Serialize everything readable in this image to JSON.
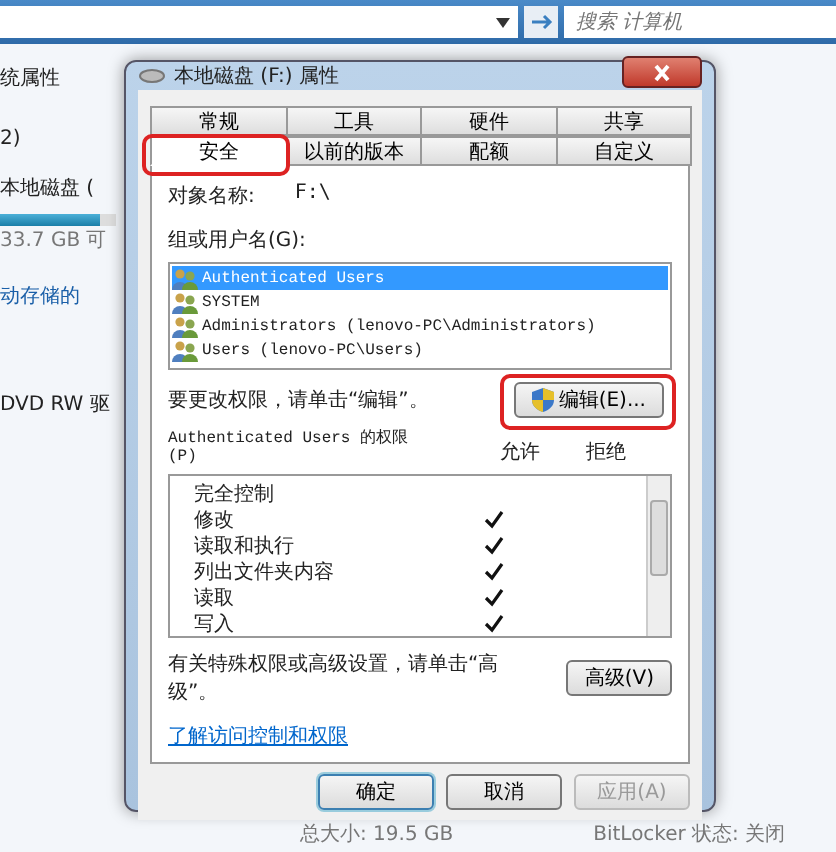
{
  "explorer": {
    "search": {
      "placeholder": "搜索 计算机"
    },
    "toolbar_item": "统属性",
    "section": "2)",
    "drive_name": "本地磁盘 (",
    "drive_bar": {
      "level": 0.63
    },
    "drive_free": "33.7 GB 可",
    "removable": "动存储的",
    "dvd": "DVD RW 驱",
    "total": "总大小: 19.5 GB",
    "bitlocker": "BitLocker 状态: 关闭"
  },
  "dialog": {
    "title": "本地磁盘 (F:) 属性",
    "tabs": [
      [
        {
          "label": "常规",
          "selected": false
        },
        {
          "label": "工具",
          "selected": false
        },
        {
          "label": "硬件",
          "selected": false
        },
        {
          "label": "共享",
          "selected": false
        }
      ],
      [
        {
          "label": "安全",
          "selected": true
        },
        {
          "label": "以前的版本",
          "selected": false
        },
        {
          "label": "配额",
          "selected": false
        },
        {
          "label": "自定义",
          "selected": false
        }
      ]
    ],
    "object_label": "对象名称:",
    "object_value": "F:\\",
    "groups_label": "组或用户名(G):",
    "users": [
      {
        "name": "Authenticated Users",
        "selected": true
      },
      {
        "name": "SYSTEM",
        "selected": false
      },
      {
        "name": "Administrators (lenovo-PC\\Administrators)",
        "selected": false
      },
      {
        "name": "Users (lenovo-PC\\Users)",
        "selected": false
      }
    ],
    "edit_hint": "要更改权限，请单击“编辑”。",
    "edit_button": "编辑(E)...",
    "perm_title": "Authenticated Users 的权限",
    "perm_key": "(P)",
    "allow_label": "允许",
    "deny_label": "拒绝",
    "permissions": [
      {
        "name": "完全控制",
        "allow": false
      },
      {
        "name": "修改",
        "allow": true
      },
      {
        "name": "读取和执行",
        "allow": true
      },
      {
        "name": "列出文件夹内容",
        "allow": true
      },
      {
        "name": "读取",
        "allow": true
      },
      {
        "name": "写入",
        "allow": true
      }
    ],
    "advanced_hint": "有关特殊权限或高级设置，请单击“高级”。",
    "advanced_button": "高级(V)",
    "link": "了解访问控制和权限",
    "buttons": [
      {
        "label": "确定",
        "disabled": false
      },
      {
        "label": "取消",
        "disabled": false
      },
      {
        "label": "应用(A)",
        "disabled": true
      }
    ]
  }
}
